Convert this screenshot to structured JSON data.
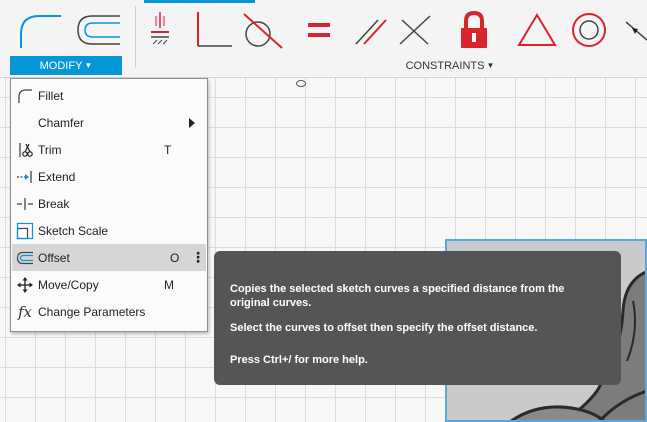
{
  "toolbar": {
    "active_tab_color": "#0696d7",
    "modify_group": {
      "label": "MODIFY",
      "caret": "▼",
      "tools": [
        {
          "icon": "fillet-icon"
        },
        {
          "icon": "offset-icon"
        }
      ]
    },
    "constraints_group": {
      "label": "CONSTRAINTS",
      "caret": "▼",
      "tools": [
        {
          "icon": "coincident-icon"
        },
        {
          "icon": "perpendicular-icon"
        },
        {
          "icon": "tangent-icon"
        },
        {
          "icon": "equal-icon"
        },
        {
          "icon": "parallel-icon"
        },
        {
          "icon": "collinear-icon"
        },
        {
          "icon": "fix-lock-icon"
        },
        {
          "icon": "triangle-icon"
        },
        {
          "icon": "concentric-icon"
        },
        {
          "icon": "midpoint-icon"
        }
      ]
    }
  },
  "menu": {
    "items": [
      {
        "label": "Fillet",
        "icon": "fillet-icon"
      },
      {
        "label": "Chamfer",
        "icon": "",
        "submenu": true
      },
      {
        "label": "Trim",
        "icon": "trim-icon",
        "shortcut": "T"
      },
      {
        "label": "Extend",
        "icon": "extend-icon"
      },
      {
        "label": "Break",
        "icon": "break-icon"
      },
      {
        "label": "Sketch Scale",
        "icon": "sketch-scale-icon"
      },
      {
        "label": "Offset",
        "icon": "offset-icon",
        "shortcut": "O",
        "more": "⋮",
        "highlighted": true
      },
      {
        "label": "Move/Copy",
        "icon": "move-copy-icon",
        "shortcut": "M"
      },
      {
        "label": "Change Parameters",
        "icon": "fx-icon",
        "icon_text": "fx"
      }
    ]
  },
  "tooltip": {
    "description": "Copies the selected sketch curves a specified distance from the original curves.",
    "instruction": "Select the curves to offset then specify the offset distance.",
    "help": "Press Ctrl+/ for more help."
  },
  "colors": {
    "highlight": "#d6d6d6",
    "tooltip_bg": "#555555",
    "constraint_red": "#d9232d",
    "selection_blue": "#5aa7e0"
  }
}
